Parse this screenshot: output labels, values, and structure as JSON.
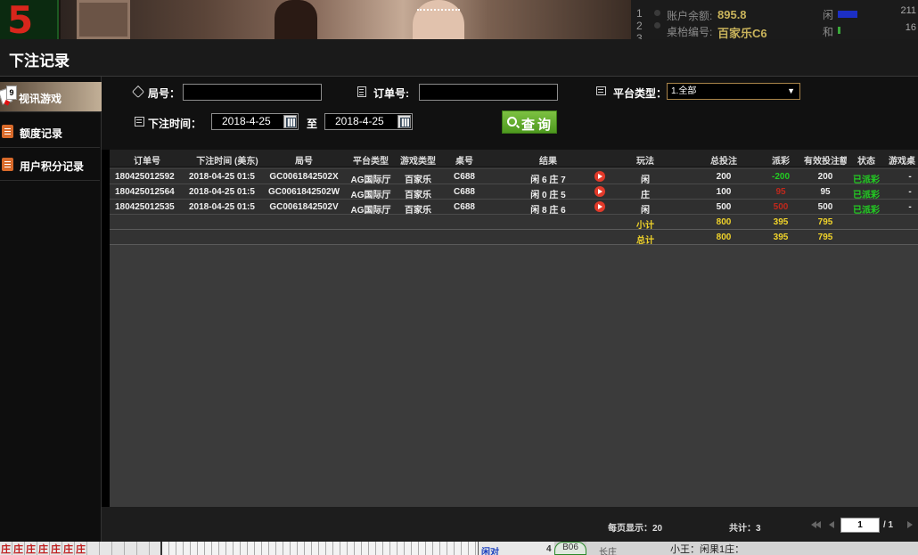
{
  "top_strip": {
    "big_number": "5",
    "rows": [
      {
        "index": "1",
        "label": "账户余额:",
        "value": "895.8"
      },
      {
        "index": "2",
        "label": "桌枱编号:",
        "value": "百家乐C6"
      },
      {
        "index": "3",
        "label": "",
        "value": ""
      }
    ],
    "side": [
      {
        "label": "闲",
        "num": "211"
      },
      {
        "label": "和",
        "num": "16"
      }
    ],
    "colors": {
      "bar_player": "#1c2fc4",
      "bar_tie": "#3aa83a"
    }
  },
  "header": {
    "title": "下注记录"
  },
  "sidebar": {
    "items": [
      {
        "label": "视讯游戏",
        "icon": "playing-cards-icon",
        "active": true,
        "card_rank": "9"
      },
      {
        "label": "额度记录",
        "icon": "document-icon",
        "active": false
      },
      {
        "label": "用户积分记录",
        "icon": "document-icon",
        "active": false
      }
    ]
  },
  "filters": {
    "round_label": "局号：",
    "round_value": "",
    "order_label": "订单号:",
    "order_value": "",
    "platform_label": "平台类型：",
    "platform_selected": "1.全部",
    "time_label": "下注时间：",
    "date_from": "2018-4-25",
    "to_label": "至",
    "date_to": "2018-4-25",
    "query_label": "查询"
  },
  "table": {
    "columns": [
      "订单号",
      "下注时间 (美东)",
      "局号",
      "平台类型",
      "游戏类型",
      "桌号",
      "结果",
      "玩法",
      "总投注",
      "派彩",
      "有效投注额",
      "状态",
      "游戏桌"
    ],
    "rows": [
      {
        "order": "180425012592",
        "time": "2018-04-25 01:5",
        "round": "GC0061842502X",
        "platform": "AG国际厅",
        "game": "百家乐",
        "table": "C688",
        "result": "闲 6 庄 7",
        "play": "闲",
        "bet": "200",
        "payout": "-200",
        "valid": "200",
        "status": "已派彩",
        "extra": "-"
      },
      {
        "order": "180425012564",
        "time": "2018-04-25 01:5",
        "round": "GC0061842502W",
        "platform": "AG国际厅",
        "game": "百家乐",
        "table": "C688",
        "result": "闲 0 庄 5",
        "play": "庄",
        "bet": "100",
        "payout": "95",
        "valid": "95",
        "status": "已派彩",
        "extra": "-"
      },
      {
        "order": "180425012535",
        "time": "2018-04-25 01:5",
        "round": "GC0061842502V",
        "platform": "AG国际厅",
        "game": "百家乐",
        "table": "C688",
        "result": "闲 8 庄 6",
        "play": "闲",
        "bet": "500",
        "payout": "500",
        "valid": "500",
        "status": "已派彩",
        "extra": "-"
      }
    ],
    "subtotal": {
      "label": "小计",
      "bet": "800",
      "payout": "395",
      "valid": "795"
    },
    "total": {
      "label": "总计",
      "bet": "800",
      "payout": "395",
      "valid": "795"
    },
    "colors": {
      "loss": "#22cc22",
      "win": "#c0281c",
      "status": "#22cc22",
      "sum": "#f0d32a"
    }
  },
  "footer": {
    "per_page_label": "每页显示：20",
    "total_label": "共计：3",
    "page_value": "1",
    "page_total": "/ 1"
  },
  "bottom_strip": {
    "road_chars": [
      "庄",
      "庄",
      "庄",
      "庄",
      "庄",
      "庄",
      "庄"
    ],
    "mid_text": "闲对",
    "mid_num": "4",
    "circle_text": "B06",
    "right_text1": "长庄",
    "right_text2": "小王：闲果1庄："
  }
}
